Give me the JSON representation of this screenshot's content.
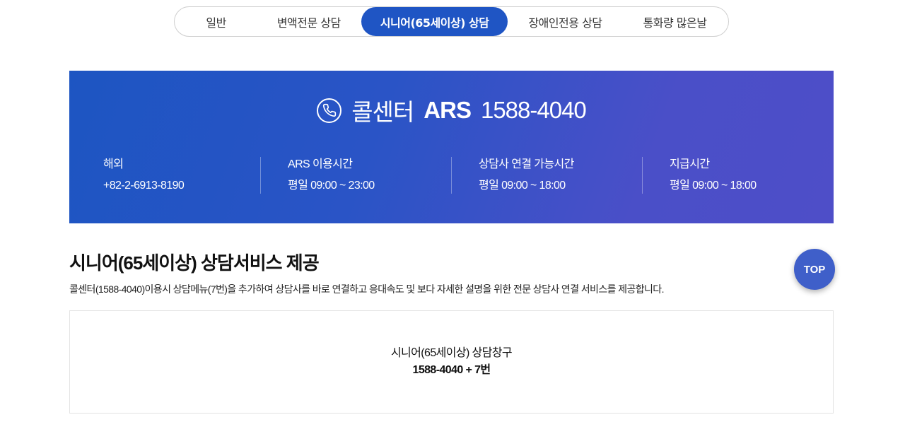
{
  "tabs": [
    {
      "label": "일반",
      "active": false
    },
    {
      "label": "변액전문 상담",
      "active": false
    },
    {
      "label": "시니어(65세이상) 상담",
      "active": true
    },
    {
      "label": "장애인전용 상담",
      "active": false
    },
    {
      "label": "통화량 많은날",
      "active": false
    }
  ],
  "banner": {
    "icon": "phone-icon",
    "title_label": "콜센터",
    "title_ars": "ARS",
    "title_number": "1588-4040",
    "info": [
      {
        "label": "해외",
        "value": "+82-2-6913-8190"
      },
      {
        "label": "ARS 이용시간",
        "value": "평일 09:00 ~ 23:00"
      },
      {
        "label": "상담사 연결 가능시간",
        "value": "평일 09:00 ~ 18:00"
      },
      {
        "label": "지급시간",
        "value": "평일 09:00 ~ 18:00"
      }
    ]
  },
  "section": {
    "title": "시니어(65세이상) 상담서비스 제공",
    "description": "콜센터(1588-4040)이용시 상담메뉴(7번)을 추가하여 상담사를 바로 연결하고 응대속도 및 보다 자세한 설명을 위한 전문 상담사 연결 서비스를 제공합니다.",
    "box_line1": "시니어(65세이상) 상담창구",
    "box_line2": "1588-4040 + 7번"
  },
  "top_button": "TOP",
  "colors": {
    "accent": "#1f55c4",
    "banner_start": "#1d55c2",
    "banner_end": "#4e4ec8",
    "top_button": "#3f5fc9"
  }
}
